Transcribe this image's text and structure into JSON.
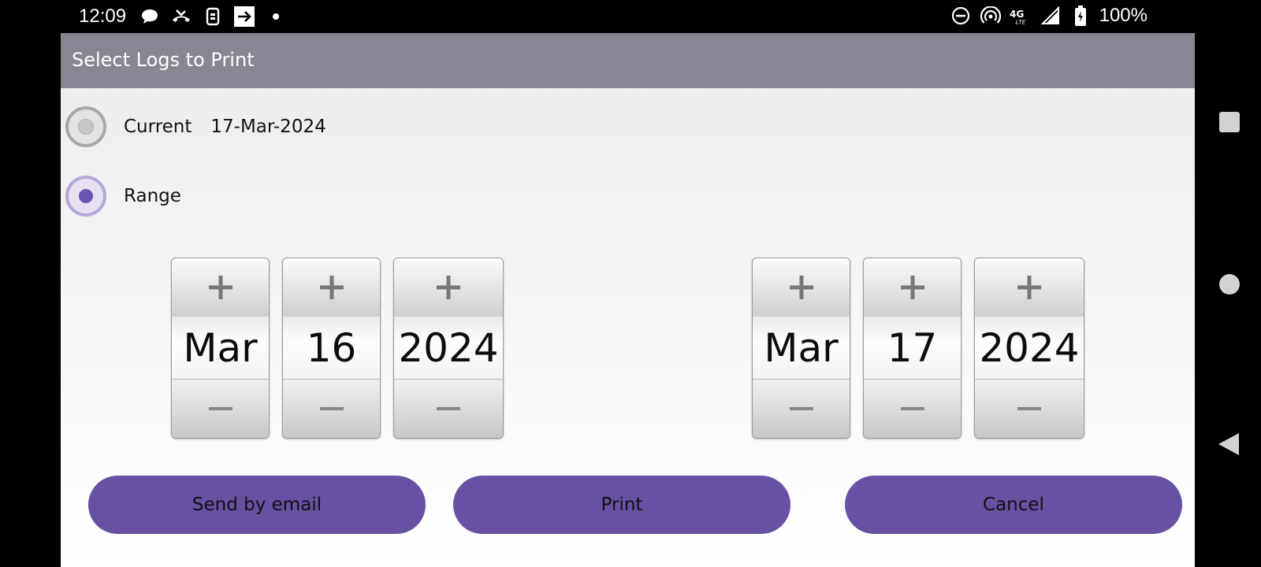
{
  "status_bar": {
    "time": "12:09",
    "left_icons": [
      "chat-bubble-icon",
      "missed-call-icon",
      "sim-icon",
      "arrow-box-icon",
      "dot-icon"
    ],
    "right_icons": [
      "do-not-disturb-icon",
      "hotspot-icon",
      "4g-lte-icon",
      "signal-icon",
      "battery-icon"
    ],
    "battery": "100%"
  },
  "dialog": {
    "title": "Select Logs to Print",
    "title_bar_color": "#878793",
    "options": {
      "current": {
        "label": "Current",
        "date": "17-Mar-2024",
        "selected": false
      },
      "range": {
        "label": "Range",
        "selected": true
      }
    },
    "range_from": {
      "month": "Mar",
      "day": "16",
      "year": "2024"
    },
    "range_to": {
      "month": "Mar",
      "day": "17",
      "year": "2024"
    },
    "buttons": {
      "email": "Send by email",
      "print": "Print",
      "cancel": "Cancel"
    },
    "accent_color": "#6851a3"
  },
  "nav_bar": {
    "icons": [
      "recents-square-icon",
      "home-circle-icon",
      "back-triangle-icon"
    ]
  }
}
